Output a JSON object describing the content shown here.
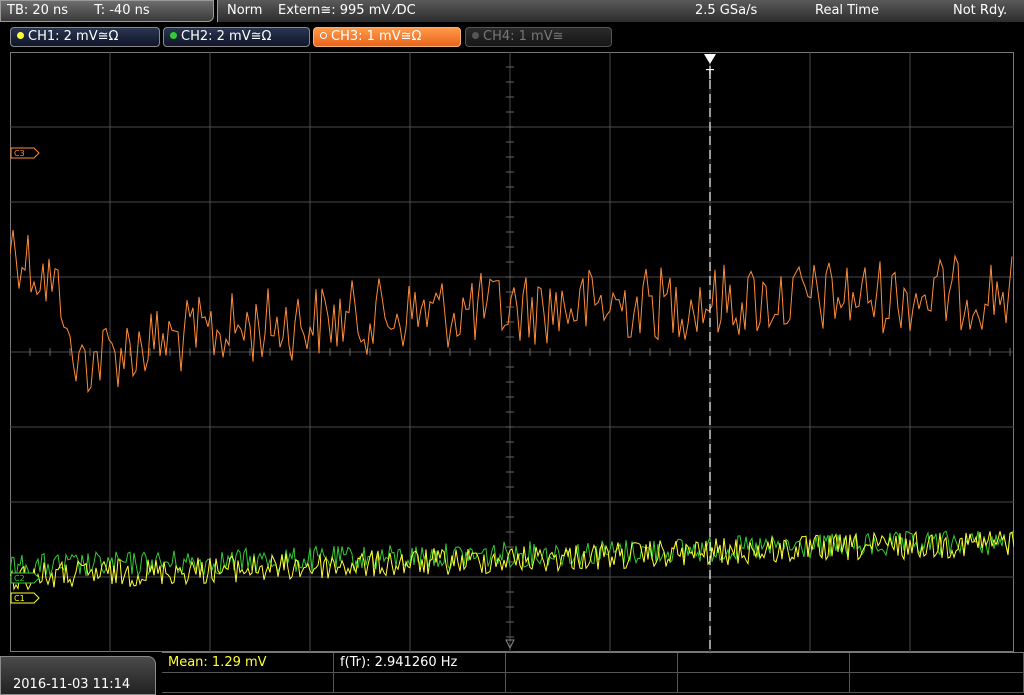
{
  "header": {
    "timebase": "TB: 20 ns",
    "trigger_pos": "T: -40 ns",
    "mode": "Norm",
    "trigger_source": "Extern≅: 995 mV ⁄DC",
    "sample_rate": "2.5 GSa/s",
    "acq_mode": "Real Time",
    "state": "Not Rdy."
  },
  "channels": [
    {
      "label": "CH1: 2 mV≅Ω",
      "color": "#ffff33",
      "state": "on"
    },
    {
      "label": "CH2: 2 mV≅Ω",
      "color": "#33cc33",
      "state": "on"
    },
    {
      "label": "CH3: 1 mV≅Ω",
      "color": "#ff8c3a",
      "state": "active"
    },
    {
      "label": "CH4: 1 mV≅",
      "color": "#777777",
      "state": "off"
    }
  ],
  "markers": {
    "ch3": "C3",
    "ch2": "C2",
    "ch1": "C1",
    "trigger": "T"
  },
  "footer": {
    "datetime": "2016-11-03 11:14",
    "mean": "Mean: 1.29 mV",
    "freq": "f(Tr): 2.941260 Hz"
  },
  "colors": {
    "grid": "#4a4a4a",
    "ch1": "#ffff33",
    "ch2": "#33cc33",
    "ch3": "#ff8c3a"
  }
}
